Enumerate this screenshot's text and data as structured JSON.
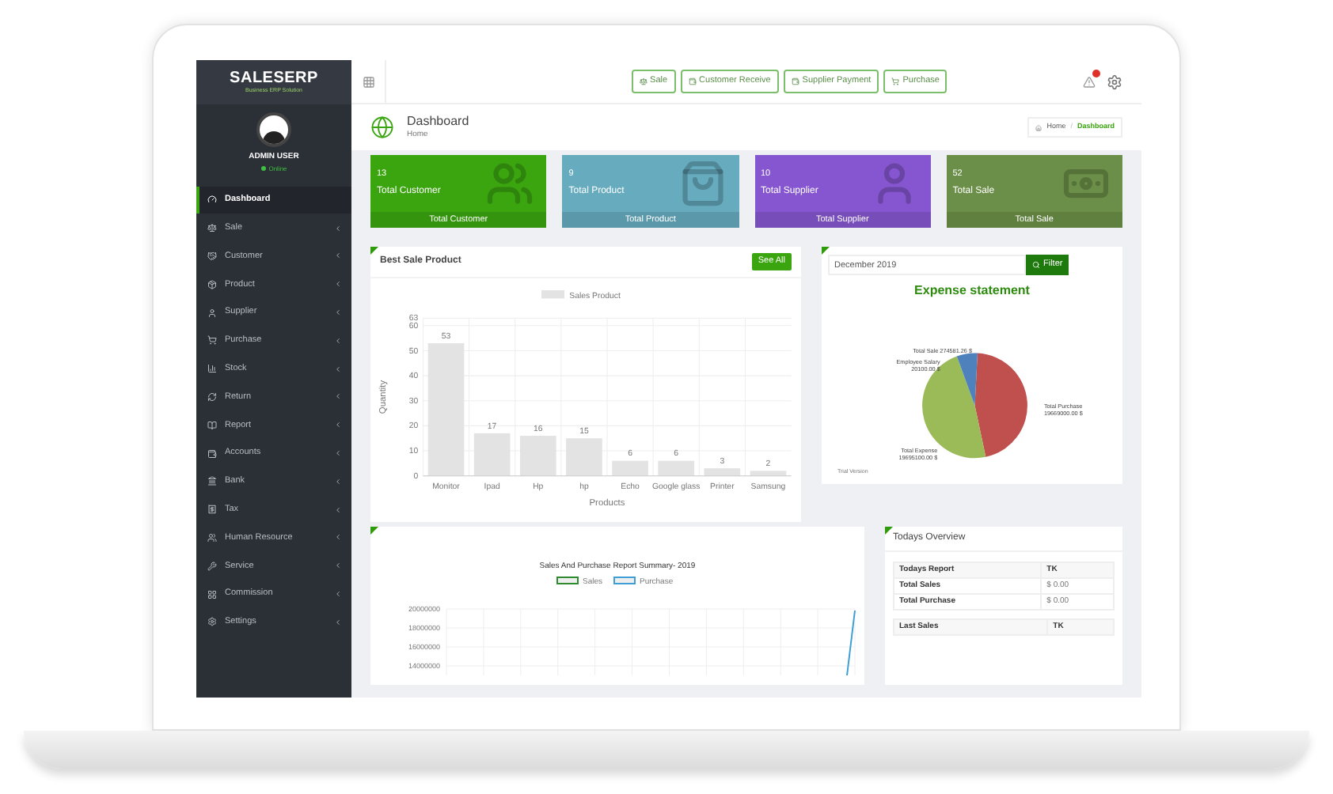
{
  "sidebar": {
    "logo": "SALESERP",
    "tagline": "Business ERP Solution",
    "user": {
      "name": "ADMIN USER",
      "status": "Online",
      "online": true
    },
    "items": [
      {
        "label": "Dashboard",
        "selected": true,
        "has_children": false
      },
      {
        "label": "Sale",
        "selected": false,
        "has_children": true
      },
      {
        "label": "Customer",
        "selected": false,
        "has_children": true
      },
      {
        "label": "Product",
        "selected": false,
        "has_children": true
      },
      {
        "label": "Supplier",
        "selected": false,
        "has_children": true
      },
      {
        "label": "Purchase",
        "selected": false,
        "has_children": true
      },
      {
        "label": "Stock",
        "selected": false,
        "has_children": true
      },
      {
        "label": "Return",
        "selected": false,
        "has_children": true
      },
      {
        "label": "Report",
        "selected": false,
        "has_children": true
      },
      {
        "label": "Accounts",
        "selected": false,
        "has_children": true
      },
      {
        "label": "Bank",
        "selected": false,
        "has_children": true
      },
      {
        "label": "Tax",
        "selected": false,
        "has_children": true
      },
      {
        "label": "Human Resource",
        "selected": false,
        "has_children": true
      },
      {
        "label": "Service",
        "selected": false,
        "has_children": true
      },
      {
        "label": "Commission",
        "selected": false,
        "has_children": true
      },
      {
        "label": "Settings",
        "selected": false,
        "has_children": true
      }
    ]
  },
  "toolbar": {
    "quick_buttons": [
      "Sale",
      "Customer Receive",
      "Supplier Payment",
      "Purchase"
    ]
  },
  "header": {
    "title": "Dashboard",
    "subtitle": "Home",
    "breadcrumb": [
      {
        "label": "Home",
        "selected": false
      },
      {
        "label": "Dashboard",
        "selected": true
      }
    ],
    "breadcrumb_separator": "/"
  },
  "cards": [
    {
      "value": "13",
      "label": "Total Customer",
      "footer": "Total Customer",
      "color": "#3aa50f"
    },
    {
      "value": "9",
      "label": "Total Product",
      "footer": "Total Product",
      "color": "#66abbe"
    },
    {
      "value": "10",
      "label": "Total Supplier",
      "footer": "Total Supplier",
      "color": "#8556cf"
    },
    {
      "value": "52",
      "label": "Total Sale",
      "footer": "Total Sale",
      "color": "#6b8f48"
    }
  ],
  "best_sale_product": {
    "title": "Best Sale Product",
    "button": "See All",
    "chart_data": {
      "type": "bar",
      "grid": true,
      "xlabel": "Products",
      "ylabel": "Quantity",
      "categories": [
        "Monitor",
        "Ipad",
        "Hp",
        "hp",
        "Echo",
        "Google glass",
        "Printer",
        "Samsung"
      ],
      "series": [
        {
          "name": "Sales Product",
          "color": "#e3e3e3",
          "values": [
            53,
            17,
            16,
            15,
            6,
            6,
            3,
            2
          ]
        }
      ],
      "ylim": [
        0,
        63
      ],
      "yticks": [
        0,
        10,
        20,
        30,
        40,
        50,
        60,
        63
      ],
      "data_labels": true
    }
  },
  "expense": {
    "date_value": "December 2019",
    "filter_button": "Filter",
    "title": "Expense statement",
    "pie_labels": [
      {
        "kind": "left",
        "lines": [
          "Total Sale 274581.26 $"
        ]
      },
      {
        "kind": "left",
        "lines": [
          "Employee Salary",
          "20100.00 $"
        ]
      },
      {
        "kind": "right",
        "lines": [
          "Total Purchase",
          "19669000.00 $"
        ]
      },
      {
        "kind": "left",
        "lines": [
          "Total Expense",
          "19695100.00 $"
        ]
      }
    ],
    "footnote": "Trial Version"
  },
  "sales_purchase": {
    "title": "Sales And Purchase Report Summary- 2019",
    "legend": [
      {
        "name": "Sales",
        "color": "#2e8b2e"
      },
      {
        "name": "Purchase",
        "color": "#3e9fd6"
      }
    ],
    "y_tick_labels": [
      "20000000",
      "18000000",
      "16000000",
      "14000000"
    ]
  },
  "todays_overview": {
    "title": "Todays Overview",
    "tables": [
      {
        "columns": [
          "Todays Report",
          "TK"
        ],
        "rows": [
          [
            "Total Sales",
            "$ 0.00"
          ],
          [
            "Total Purchase",
            "$ 0.00"
          ]
        ]
      },
      {
        "columns": [
          "Last Sales",
          "TK"
        ]
      }
    ]
  }
}
